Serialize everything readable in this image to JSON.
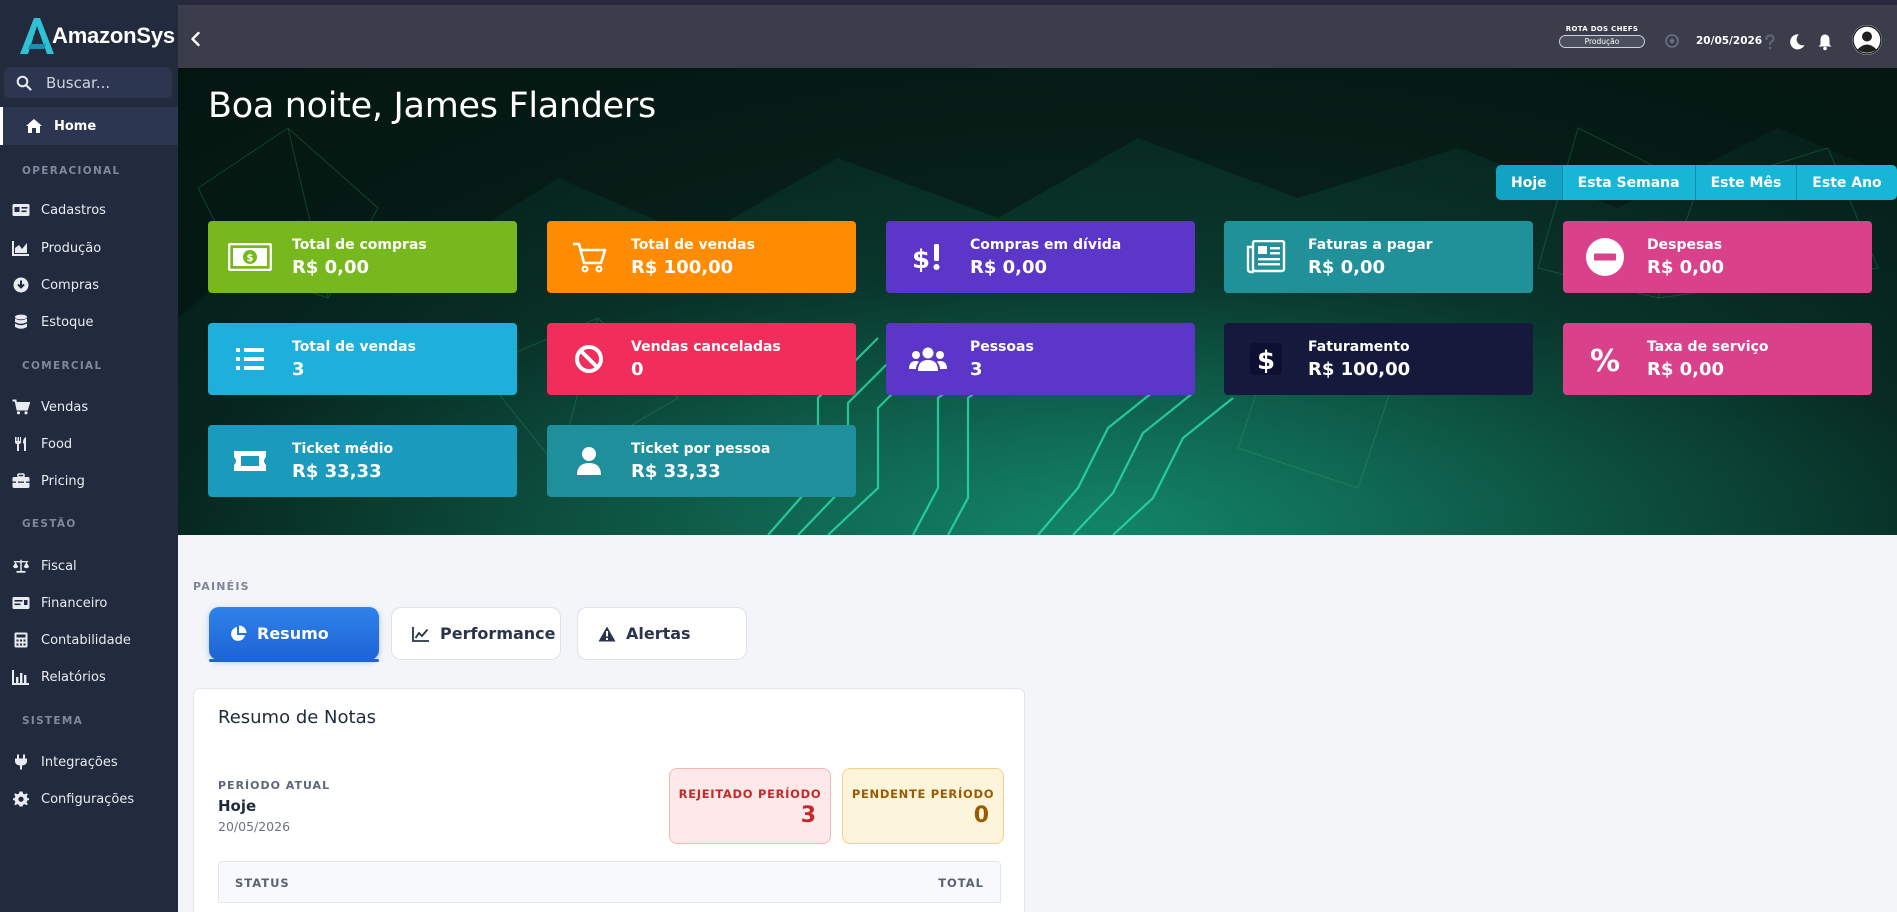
{
  "app": {
    "name": "AmazonSys"
  },
  "sidebar": {
    "search_placeholder": "Buscar...",
    "home_label": "Home",
    "sections": {
      "operacional": "OPERACIONAL",
      "comercial": "COMERCIAL",
      "gestao": "GESTÃO",
      "sistema": "SISTEMA"
    },
    "items": {
      "cadastros": "Cadastros",
      "producao": "Produção",
      "compras": "Compras",
      "estoque": "Estoque",
      "vendas": "Vendas",
      "food": "Food",
      "pricing": "Pricing",
      "fiscal": "Fiscal",
      "financeiro": "Financeiro",
      "contabilidade": "Contabilidade",
      "relatorios": "Relatórios",
      "integracoes": "Integrações",
      "configuracoes": "Configurações"
    }
  },
  "topbar": {
    "store_name": "ROTA DOS CHEFS",
    "store_env": "Produção",
    "date": "20/05/2026"
  },
  "hero": {
    "greeting": "Boa noite, James Flanders",
    "periods": [
      "Hoje",
      "Esta Semana",
      "Este Mês",
      "Este Ano"
    ],
    "active_period": "Hoje"
  },
  "cards": [
    {
      "title": "Total de compras",
      "value": "R$ 0,00",
      "color": "#76b81d",
      "icon": "money-icon"
    },
    {
      "title": "Total de vendas",
      "value": "R$ 100,00",
      "color": "#ff8c00",
      "icon": "cart-icon"
    },
    {
      "title": "Compras em dívida",
      "value": "R$ 0,00",
      "color": "#5b36c8",
      "icon": "dollar-alert-icon"
    },
    {
      "title": "Faturas a pagar",
      "value": "R$ 0,00",
      "color": "#209198",
      "icon": "invoice-icon"
    },
    {
      "title": "Despesas",
      "value": "R$ 0,00",
      "color": "#d9418b",
      "icon": "minus-circle-icon"
    },
    {
      "title": "Total de vendas",
      "value": "3",
      "color": "#1eb0dc",
      "icon": "list-icon"
    },
    {
      "title": "Vendas canceladas",
      "value": "0",
      "color": "#f02d5b",
      "icon": "ban-icon"
    },
    {
      "title": "Pessoas",
      "value": "3",
      "color": "#5b36c8",
      "icon": "users-icon"
    },
    {
      "title": "Faturamento",
      "value": "R$ 100,00",
      "color": "#15193b",
      "icon": "dollar-icon"
    },
    {
      "title": "Taxa de serviço",
      "value": "R$ 0,00",
      "color": "#d9418b",
      "icon": "percent-icon"
    },
    {
      "title": "Ticket médio",
      "value": "R$ 33,33",
      "color": "#1a9bbd",
      "icon": "ticket-icon"
    },
    {
      "title": "Ticket por pessoa",
      "value": "R$ 33,33",
      "color": "#1f8f9b",
      "icon": "person-icon"
    }
  ],
  "panels": {
    "label": "PAINÉIS",
    "tabs": [
      "Resumo",
      "Performance",
      "Alertas"
    ]
  },
  "notes": {
    "title": "Resumo de Notas",
    "current_label": "PERÍODO ATUAL",
    "current_value": "Hoje",
    "current_date": "20/05/2026",
    "rejected_label": "REJEITADO PERÍODO",
    "rejected_value": "3",
    "pending_label": "PENDENTE PERÍODO",
    "pending_value": "0",
    "col_status": "STATUS",
    "col_total": "TOTAL"
  }
}
